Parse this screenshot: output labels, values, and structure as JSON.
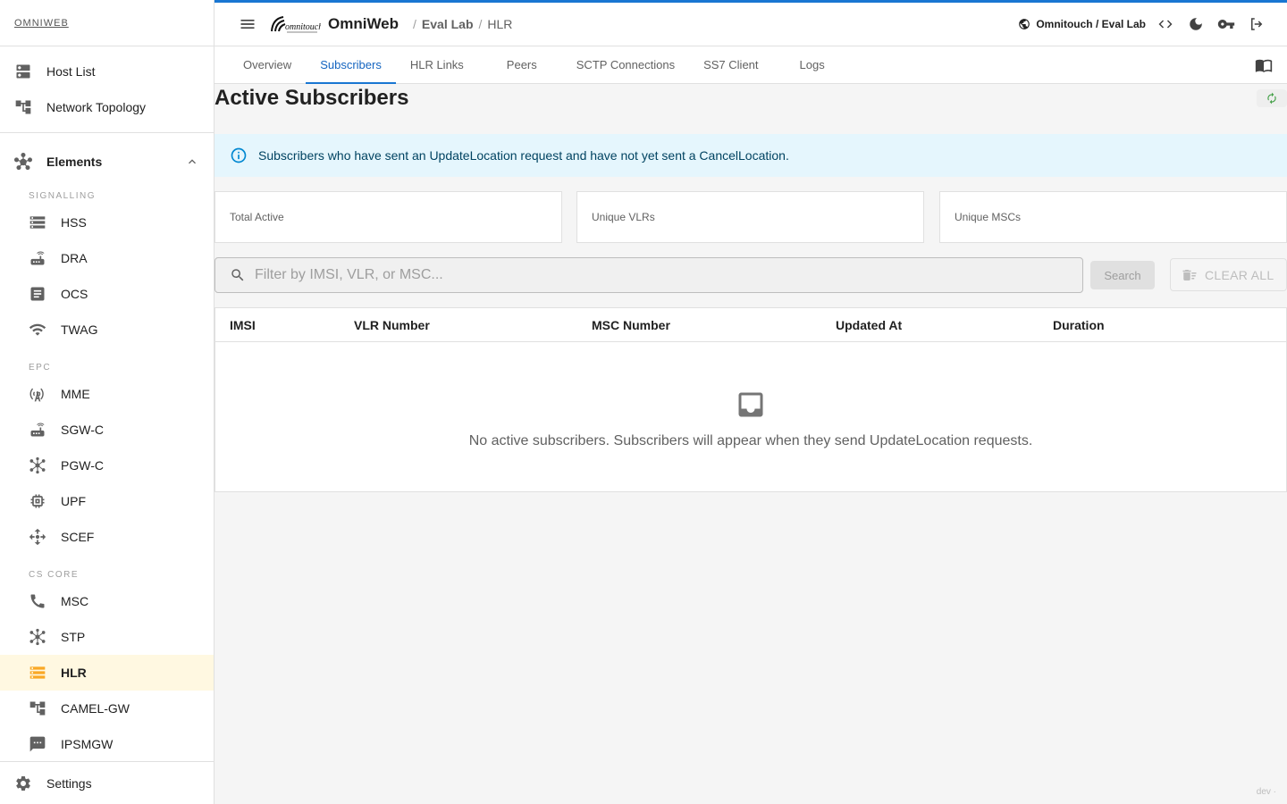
{
  "sidebar": {
    "brand": "OMNIWEB",
    "top_items": [
      {
        "label": "Host List",
        "icon": "dns-icon"
      },
      {
        "label": "Network Topology",
        "icon": "account-tree-icon"
      }
    ],
    "elements_label": "Elements",
    "sections": [
      {
        "title": "SIGNALLING",
        "items": [
          {
            "label": "HSS",
            "icon": "storage-icon"
          },
          {
            "label": "DRA",
            "icon": "router-icon"
          },
          {
            "label": "OCS",
            "icon": "receipt-icon"
          },
          {
            "label": "TWAG",
            "icon": "wifi-icon"
          }
        ]
      },
      {
        "title": "EPC",
        "items": [
          {
            "label": "MME",
            "icon": "cell-tower-icon"
          },
          {
            "label": "SGW-C",
            "icon": "router-icon"
          },
          {
            "label": "PGW-C",
            "icon": "hub-icon"
          },
          {
            "label": "UPF",
            "icon": "memory-icon"
          },
          {
            "label": "SCEF",
            "icon": "move-icon"
          }
        ]
      },
      {
        "title": "CS CORE",
        "items": [
          {
            "label": "MSC",
            "icon": "phone-icon"
          },
          {
            "label": "STP",
            "icon": "hub-icon"
          },
          {
            "label": "HLR",
            "icon": "storage-icon",
            "active": true
          },
          {
            "label": "CAMEL-GW",
            "icon": "account-tree-icon"
          },
          {
            "label": "IPSMGW",
            "icon": "sms-icon"
          }
        ]
      }
    ],
    "settings_label": "Settings"
  },
  "header": {
    "app_name": "OmniWeb",
    "breadcrumb": [
      "Eval Lab",
      "HLR"
    ],
    "tenant": "Omnitouch / Eval Lab"
  },
  "tabs": [
    "Overview",
    "Subscribers",
    "HLR Links",
    "Peers",
    "SCTP Connections",
    "SS7 Client",
    "Logs"
  ],
  "active_tab": "Subscribers",
  "main": {
    "title": "Active Subscribers",
    "info": "Subscribers who have sent an UpdateLocation request and have not yet sent a CancelLocation.",
    "stats": [
      "Total Active",
      "Unique VLRs",
      "Unique MSCs"
    ],
    "search_placeholder": "Filter by IMSI, VLR, or MSC...",
    "search_button": "Search",
    "clear_button": "CLEAR ALL",
    "columns": [
      "IMSI",
      "VLR Number",
      "MSC Number",
      "Updated At",
      "Duration"
    ],
    "empty_message": "No active subscribers. Subscribers will appear when they send UpdateLocation requests.",
    "footer": "dev ·"
  },
  "colors": {
    "accent": "#1976d2",
    "active_nav": "#fff8e1",
    "active_icon": "#f9a825",
    "info_bg": "#e5f6fd"
  }
}
